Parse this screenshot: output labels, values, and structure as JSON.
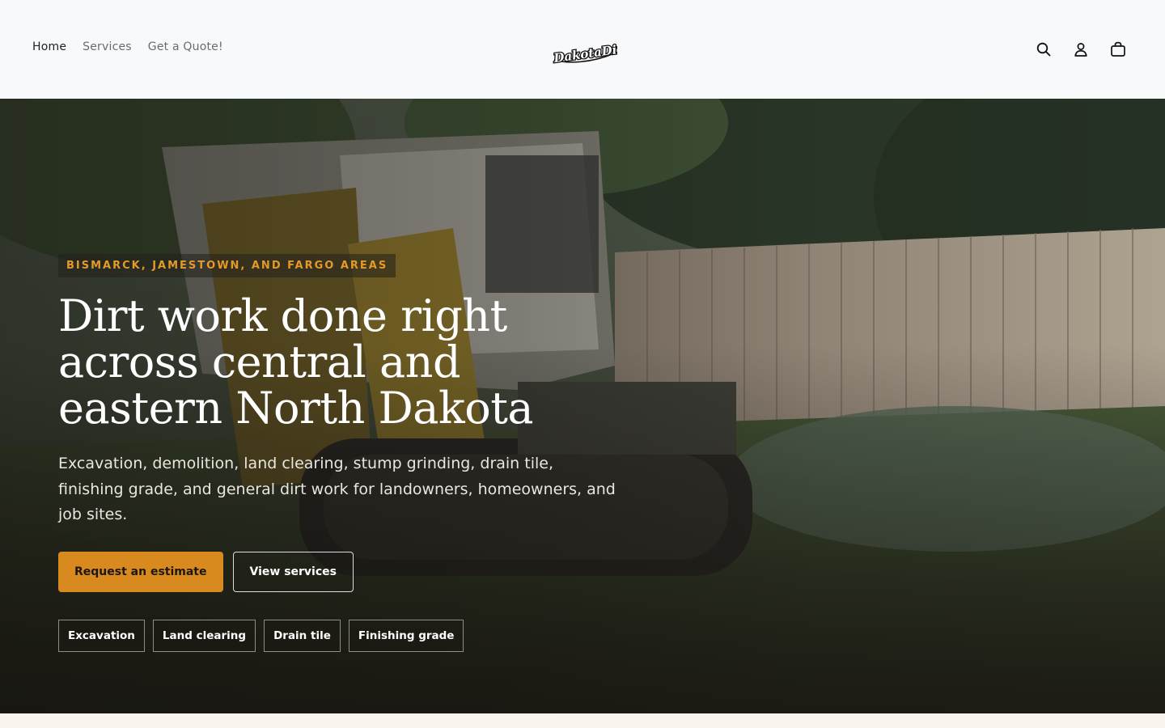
{
  "nav": {
    "items": [
      {
        "label": "Home",
        "active": true
      },
      {
        "label": "Services",
        "active": false
      },
      {
        "label": "Get a Quote!",
        "active": false
      }
    ]
  },
  "brand": {
    "logo_text": "DakotaDirt",
    "logo_icon": "script-wordmark"
  },
  "header_icons": [
    {
      "name": "search-icon"
    },
    {
      "name": "account-icon"
    },
    {
      "name": "cart-icon"
    }
  ],
  "hero": {
    "eyebrow": "BISMARCK, JAMESTOWN, AND FARGO AREAS",
    "headline": "Dirt work done right across central and eastern North Dakota",
    "subtext": "Excavation, demolition, land clearing, stump grinding, drain tile, finishing grade, and general dirt work for landowners, homeowners, and job sites.",
    "primary_cta": "Request an estimate",
    "secondary_cta": "View services",
    "tags": [
      "Excavation",
      "Land clearing",
      "Drain tile",
      "Finishing grade"
    ]
  },
  "colors": {
    "accent": "#d88a1f",
    "eyebrow": "#e39a2a",
    "header_bg": "#f8f9fb"
  }
}
